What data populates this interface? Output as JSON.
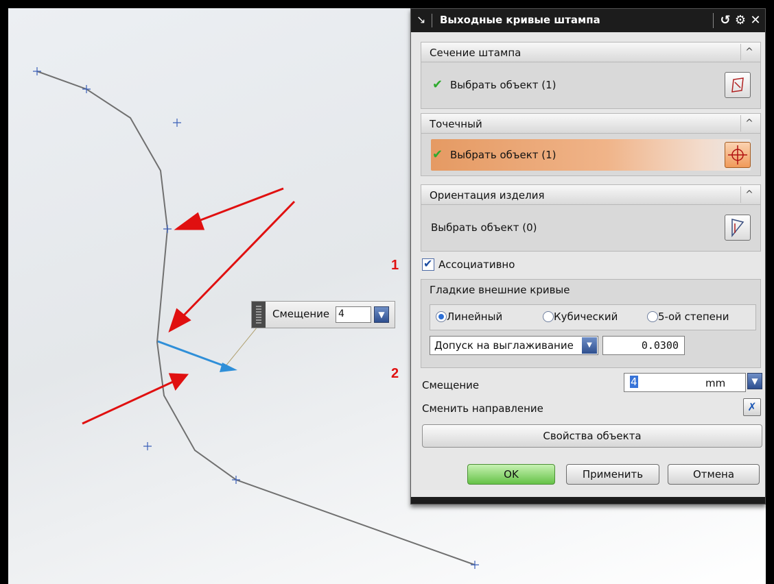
{
  "viewport": {
    "offset_tag": {
      "label": "Смещение",
      "value": "4"
    },
    "annotations": [
      "1",
      "2"
    ]
  },
  "dialog": {
    "title": "Выходные кривые штампа",
    "title_buttons": [
      "reset-icon",
      "gear-icon",
      "close-icon"
    ],
    "sections": [
      {
        "header": "Сечение штампа",
        "select_label": "Выбрать объект (1)",
        "checked": true
      },
      {
        "header": "Точечный",
        "select_label": "Выбрать объект (1)",
        "checked": true
      },
      {
        "header": "Ориентация изделия",
        "select_label": "Выбрать объект (0)",
        "checked": false
      }
    ],
    "associative": {
      "label": "Ассоциативно",
      "checked": true
    },
    "smooth_group": {
      "title": "Гладкие внешние кривые",
      "options": [
        "Линейный",
        "Кубический",
        "5-ой степени"
      ],
      "selected": "Линейный",
      "tolerance_label": "Допуск на выглаживание",
      "tolerance_value": "0.0300"
    },
    "offset": {
      "label": "Смещение",
      "value": "4",
      "unit": "mm"
    },
    "reverse_label": "Сменить направление",
    "properties_button": "Свойства объекта",
    "buttons": {
      "ok": "OK",
      "apply": "Применить",
      "cancel": "Отмена"
    },
    "accent_colors": {
      "ok": "#65c247",
      "active_row": "#e59a63",
      "arrow": "#e01010",
      "offset_vector": "#2f8fd8"
    }
  }
}
